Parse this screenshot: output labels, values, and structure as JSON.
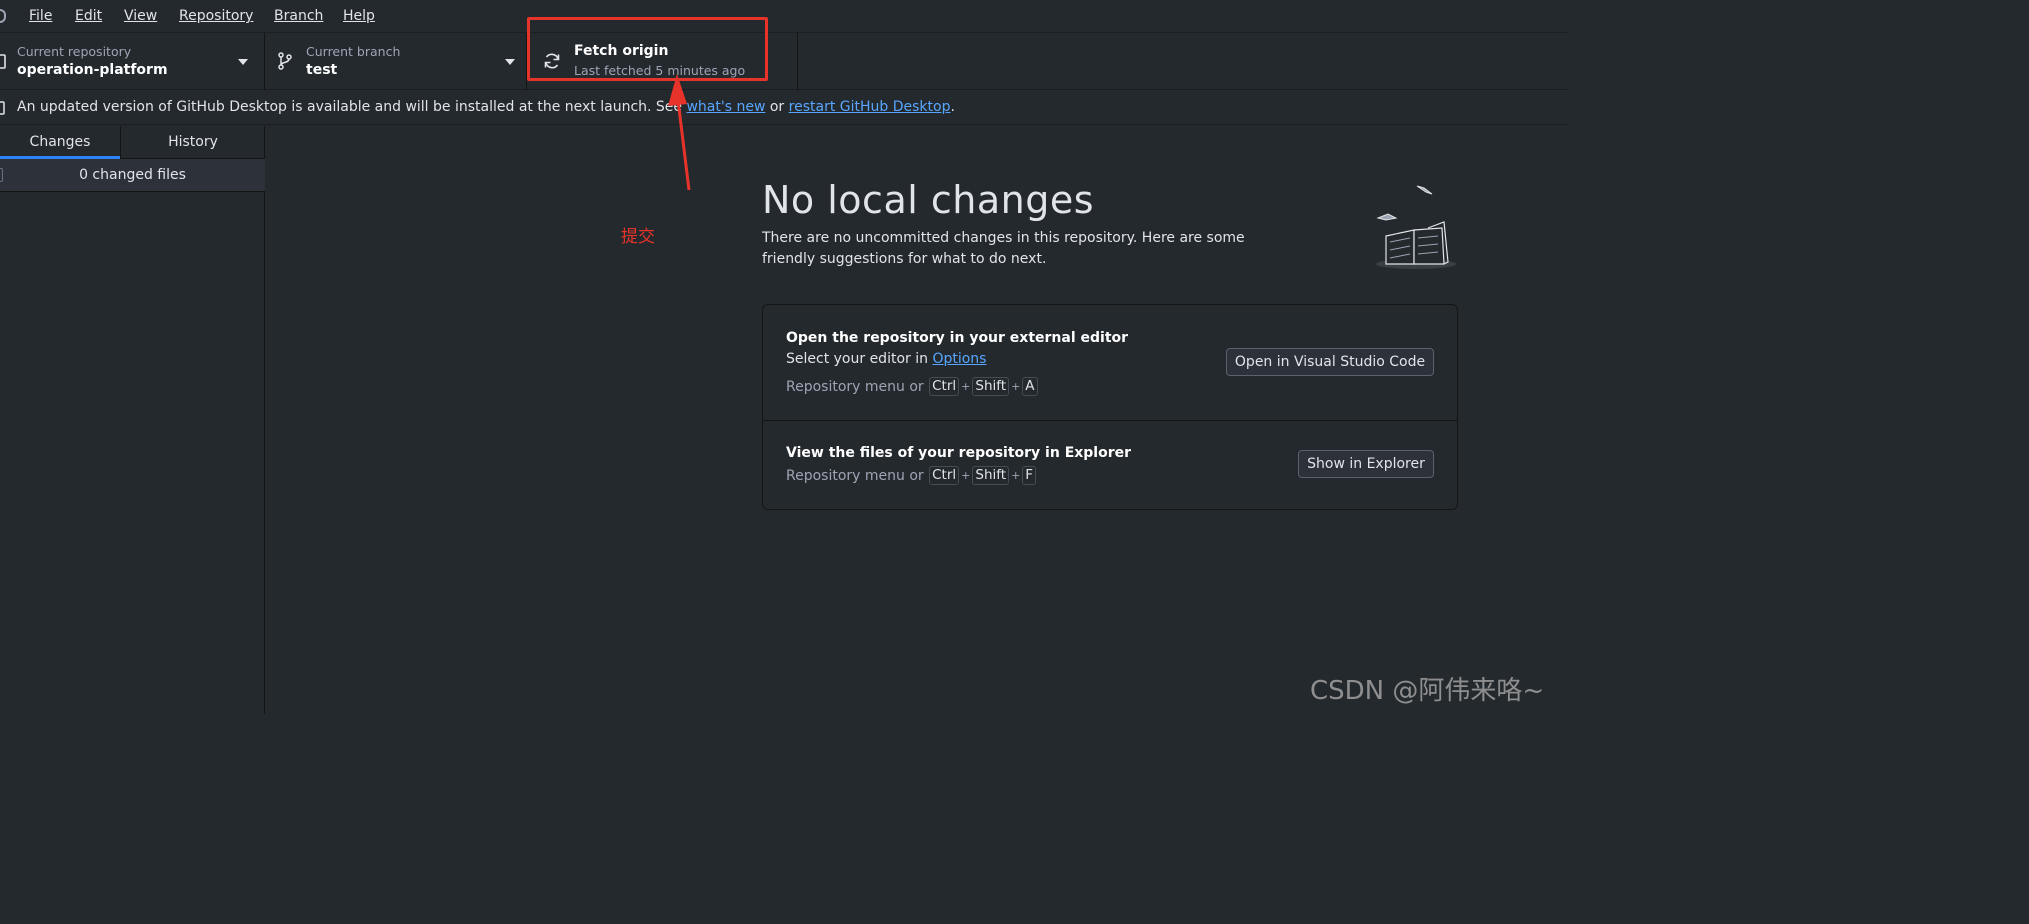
{
  "menu": {
    "items": [
      {
        "label": "File"
      },
      {
        "label": "Edit"
      },
      {
        "label": "View"
      },
      {
        "label": "Repository"
      },
      {
        "label": "Branch"
      },
      {
        "label": "Help"
      }
    ]
  },
  "toolbar": {
    "repository": {
      "label": "Current repository",
      "value": "operation-platform"
    },
    "branch": {
      "label": "Current branch",
      "value": "test"
    },
    "fetch": {
      "title": "Fetch origin",
      "subtitle": "Last fetched 5 minutes ago"
    }
  },
  "banner": {
    "text_before": "An updated version of GitHub Desktop is available and will be installed at the next launch. See ",
    "link1": "what's new",
    "text_middle": " or ",
    "link2": "restart GitHub Desktop",
    "text_after": "."
  },
  "sidebar": {
    "tabs": [
      {
        "label": "Changes",
        "active": true
      },
      {
        "label": "History",
        "active": false
      }
    ],
    "changed_files": "0 changed files"
  },
  "main": {
    "heading": "No local changes",
    "subtext": "There are no uncommitted changes in this repository. Here are some friendly suggestions for what to do next.",
    "editor_card": {
      "title": "Open the repository in your external editor",
      "desc_prefix": "Select your editor in ",
      "desc_link": "Options",
      "shortcut_prefix": "Repository menu or ",
      "keys": [
        "Ctrl",
        "Shift",
        "A"
      ],
      "button": "Open in Visual Studio Code"
    },
    "explorer_card": {
      "title": "View the files of your repository in Explorer",
      "shortcut_prefix": "Repository menu or ",
      "keys": [
        "Ctrl",
        "Shift",
        "F"
      ],
      "button": "Show in Explorer"
    }
  },
  "annotation": {
    "label": "提交",
    "color": "#e8332a"
  },
  "watermark": "CSDN @阿伟来咯~",
  "colors": {
    "background": "#24292e",
    "link": "#58a6ff",
    "active_tab": "#2f81f7"
  }
}
